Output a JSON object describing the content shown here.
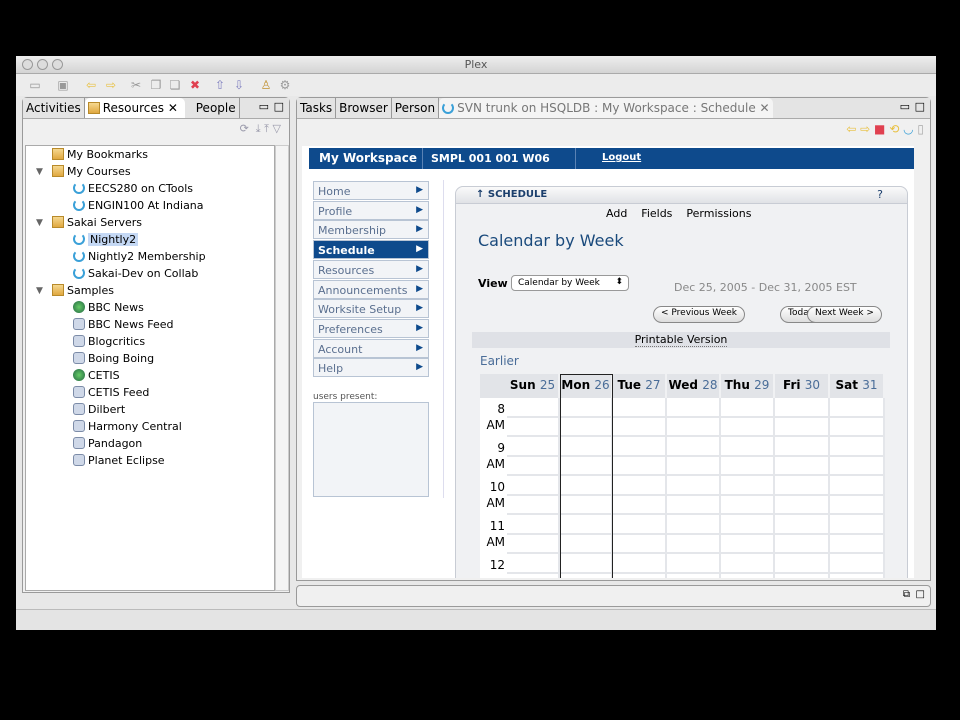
{
  "window": {
    "title": "Plex"
  },
  "left_panel": {
    "tabs": [
      "Activities",
      "Resources",
      "People"
    ],
    "active_tab": "Resources",
    "tree": [
      {
        "label": "My Bookmarks",
        "level": 0,
        "icon": "folder-icon"
      },
      {
        "label": "My Courses",
        "level": 0,
        "icon": "folder-icon",
        "expanded": true
      },
      {
        "label": "EECS280 on CTools",
        "level": 1,
        "icon": "sakai-icon"
      },
      {
        "label": "ENGIN100 At Indiana",
        "level": 1,
        "icon": "sakai-icon"
      },
      {
        "label": "Sakai Servers",
        "level": 0,
        "icon": "folder-icon",
        "expanded": true
      },
      {
        "label": "Nightly2",
        "level": 1,
        "icon": "sakai-icon",
        "selected": true
      },
      {
        "label": "Nightly2 Membership",
        "level": 1,
        "icon": "sakai-icon"
      },
      {
        "label": "Sakai-Dev on Collab",
        "level": 1,
        "icon": "sakai-icon"
      },
      {
        "label": "Samples",
        "level": 0,
        "icon": "folder-icon",
        "expanded": true
      },
      {
        "label": "BBC News",
        "level": 1,
        "icon": "globe-icon"
      },
      {
        "label": "BBC News Feed",
        "level": 1,
        "icon": "feed-icon"
      },
      {
        "label": "Blogcritics",
        "level": 1,
        "icon": "feed-icon"
      },
      {
        "label": "Boing Boing",
        "level": 1,
        "icon": "feed-icon"
      },
      {
        "label": "CETIS",
        "level": 1,
        "icon": "globe-icon"
      },
      {
        "label": "CETIS Feed",
        "level": 1,
        "icon": "feed-icon"
      },
      {
        "label": "Dilbert",
        "level": 1,
        "icon": "feed-icon"
      },
      {
        "label": "Harmony Central",
        "level": 1,
        "icon": "feed-icon"
      },
      {
        "label": "Pandagon",
        "level": 1,
        "icon": "feed-icon"
      },
      {
        "label": "Planet Eclipse",
        "level": 1,
        "icon": "feed-icon"
      }
    ]
  },
  "right_panel": {
    "tabs": [
      "Tasks",
      "Browser",
      "Person"
    ],
    "active_tab": "SVN trunk on HSQLDB : My Workspace : Schedule"
  },
  "sakai": {
    "header": {
      "workspace": "My Workspace",
      "site": "SMPL 001 001 W06",
      "logout": "Logout"
    },
    "nav": [
      "Home",
      "Profile",
      "Membership",
      "Schedule",
      "Resources",
      "Announcements",
      "Worksite Setup",
      "Preferences",
      "Account",
      "Help"
    ],
    "nav_selected": "Schedule",
    "users_present": "users present:",
    "portlet": {
      "title": "SCHEDULE",
      "help": "?",
      "actions": [
        "Add",
        "Fields",
        "Permissions"
      ],
      "heading": "Calendar by Week",
      "view_label": "View",
      "view_value": "Calendar by Week",
      "date_range": "Dec 25, 2005 - Dec 31, 2005 EST",
      "buttons": [
        "< Previous Week",
        "Today",
        "Next Week >"
      ],
      "printable": "Printable Version",
      "earlier": "Earlier",
      "days": [
        {
          "d": "Sun",
          "n": "25"
        },
        {
          "d": "Mon",
          "n": "26"
        },
        {
          "d": "Tue",
          "n": "27"
        },
        {
          "d": "Wed",
          "n": "28"
        },
        {
          "d": "Thu",
          "n": "29"
        },
        {
          "d": "Fri",
          "n": "30"
        },
        {
          "d": "Sat",
          "n": "31"
        }
      ],
      "today": "Mon",
      "hours": [
        {
          "h": "8",
          "ap": "AM"
        },
        {
          "h": "9",
          "ap": "AM"
        },
        {
          "h": "10",
          "ap": "AM"
        },
        {
          "h": "11",
          "ap": "AM"
        },
        {
          "h": "12",
          "ap": ""
        }
      ]
    }
  },
  "colors": {
    "header_blue": "#0e4a8c",
    "link_blue": "#4a6d98"
  }
}
